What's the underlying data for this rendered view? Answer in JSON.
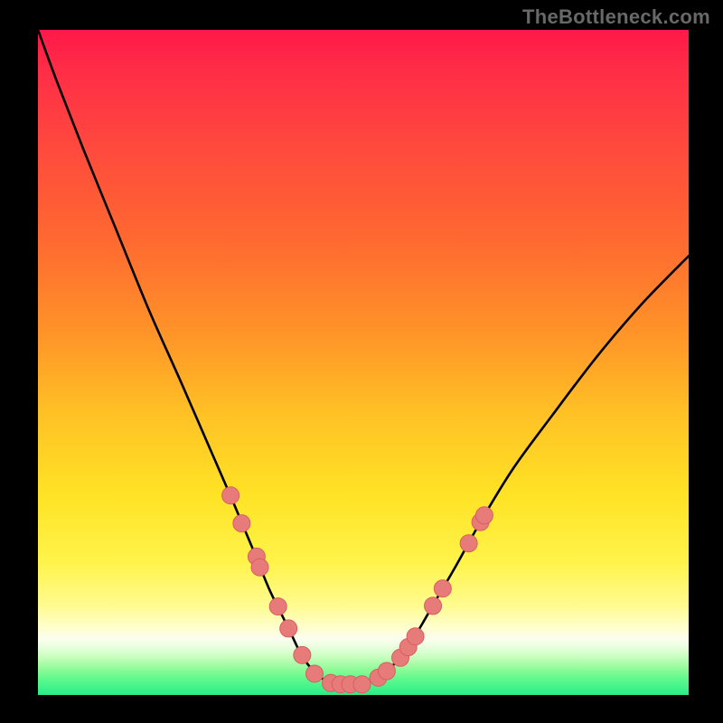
{
  "watermark": "TheBottleneck.com",
  "colors": {
    "curve": "#000000",
    "marker_fill": "#e77b7a",
    "marker_stroke": "#d85f5d",
    "gradient_top": "#ff1848",
    "gradient_bottom": "#2beb87"
  },
  "chart_data": {
    "type": "line",
    "title": "",
    "xlabel": "",
    "ylabel": "",
    "xlim": [
      0,
      100
    ],
    "ylim": [
      0,
      100
    ],
    "grid": false,
    "legend": false,
    "series": [
      {
        "name": "bottleneck-curve",
        "x": [
          0,
          3,
          7,
          12,
          17,
          22,
          26,
          30,
          33,
          35.5,
          37.5,
          39,
          40.5,
          42,
          44,
          47.5,
          49.5,
          52,
          54.5,
          57,
          59,
          61,
          64,
          68,
          73,
          79,
          86,
          93,
          100
        ],
        "y": [
          100,
          92,
          82,
          70,
          58,
          47,
          38,
          29,
          22,
          16,
          12,
          9,
          6,
          4,
          2.3,
          1.6,
          1.6,
          2.3,
          4.4,
          7.4,
          10.6,
          14,
          19,
          26,
          34,
          42,
          51,
          59,
          66
        ]
      }
    ],
    "markers": [
      {
        "name": "left-1",
        "x": 29.6,
        "y": 30.0
      },
      {
        "name": "left-2",
        "x": 31.3,
        "y": 25.8
      },
      {
        "name": "left-3",
        "x": 33.6,
        "y": 20.8
      },
      {
        "name": "left-4",
        "x": 34.1,
        "y": 19.2
      },
      {
        "name": "left-5",
        "x": 36.9,
        "y": 13.3
      },
      {
        "name": "left-6",
        "x": 38.5,
        "y": 10.0
      },
      {
        "name": "left-7",
        "x": 40.6,
        "y": 6.0
      },
      {
        "name": "left-8",
        "x": 42.5,
        "y": 3.2
      },
      {
        "name": "floor-1",
        "x": 45.0,
        "y": 1.8
      },
      {
        "name": "floor-2",
        "x": 46.5,
        "y": 1.6
      },
      {
        "name": "floor-3",
        "x": 48.0,
        "y": 1.6
      },
      {
        "name": "floor-4",
        "x": 49.8,
        "y": 1.6
      },
      {
        "name": "right-1",
        "x": 52.3,
        "y": 2.6
      },
      {
        "name": "right-2",
        "x": 53.6,
        "y": 3.6
      },
      {
        "name": "right-3",
        "x": 55.7,
        "y": 5.6
      },
      {
        "name": "right-4",
        "x": 56.9,
        "y": 7.2
      },
      {
        "name": "right-5",
        "x": 58.0,
        "y": 8.8
      },
      {
        "name": "right-6",
        "x": 60.7,
        "y": 13.4
      },
      {
        "name": "right-7",
        "x": 62.2,
        "y": 16.0
      },
      {
        "name": "right-8",
        "x": 66.2,
        "y": 22.8
      },
      {
        "name": "right-9",
        "x": 68.0,
        "y": 26.0
      },
      {
        "name": "right-10",
        "x": 68.6,
        "y": 27.0
      }
    ]
  }
}
